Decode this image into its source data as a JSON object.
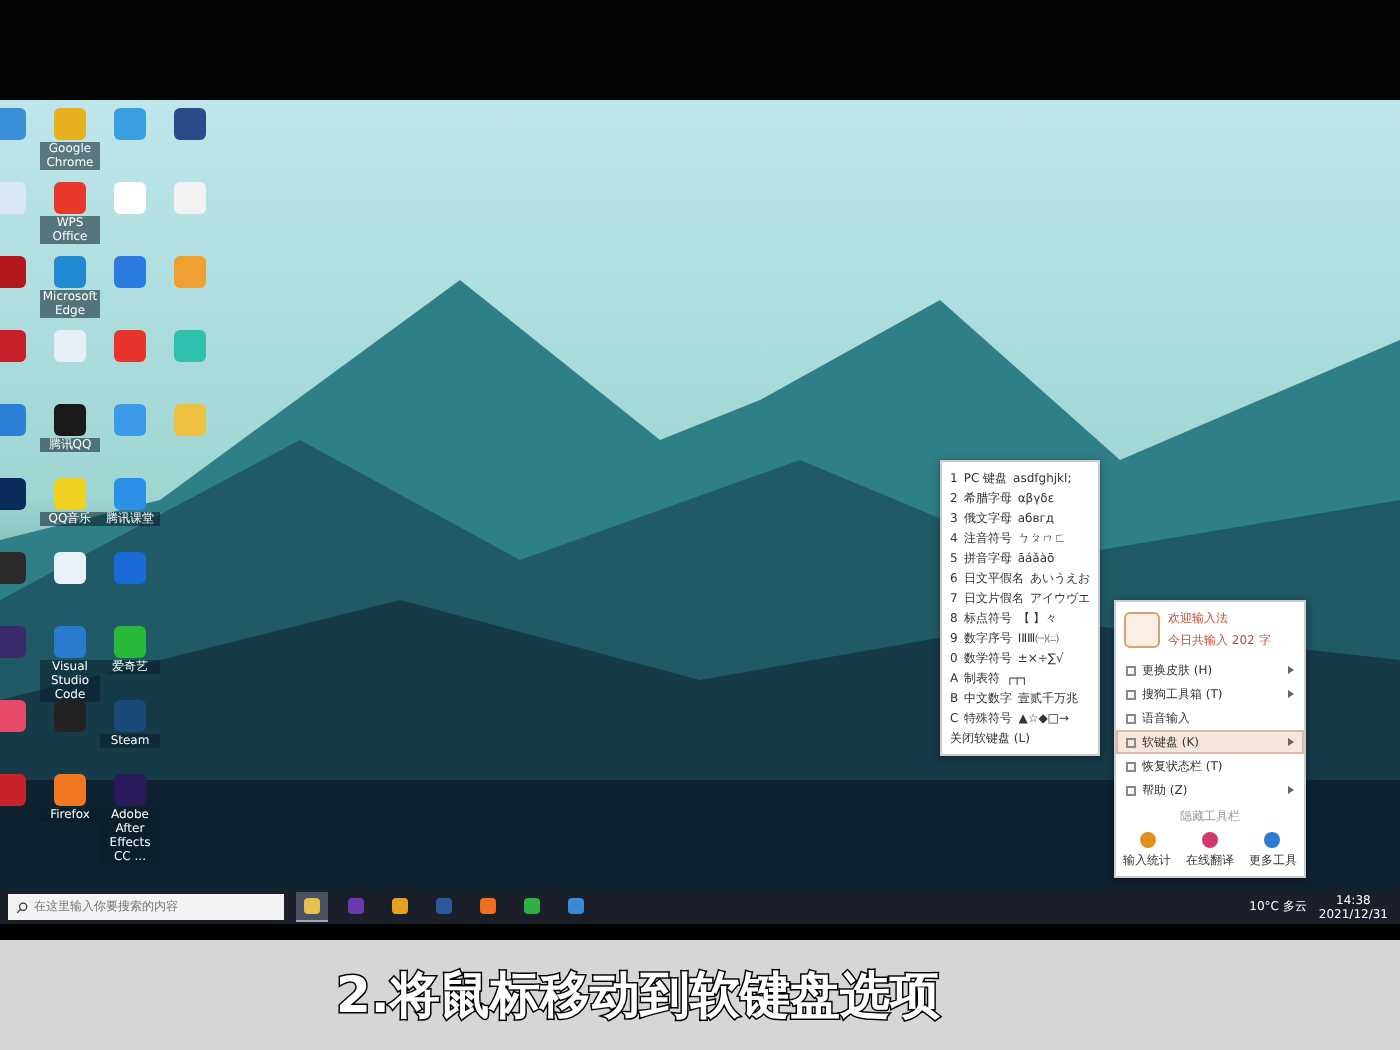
{
  "desktop_icons": [
    {
      "color": "#3a8fd8"
    },
    {
      "color": "#d9e8f5"
    },
    {
      "color": "#b0181c"
    },
    {
      "color": "#c61f2a"
    },
    {
      "color": "#2b7fd6"
    },
    {
      "color": "#0a2a5a"
    },
    {
      "color": "#2a2a2a"
    },
    {
      "color": "#3a2a6a"
    },
    {
      "color": "#e84a6a"
    },
    {
      "color": "#c8222a"
    },
    {
      "label": "Google Chrome",
      "color": "#e8b020"
    },
    {
      "label": "WPS Office",
      "color": "#e8382a"
    },
    {
      "label": "Microsoft Edge",
      "color": "#1f8ad2"
    },
    {
      "color": "#e8eef5"
    },
    {
      "label": "腾讯QQ",
      "color": "#1a1a1a"
    },
    {
      "label": "QQ音乐",
      "color": "#f0d020"
    },
    {
      "color": "#e8f0f8"
    },
    {
      "label": "Visual Studio Code",
      "color": "#2a7ad0"
    },
    {
      "color": "#222222"
    },
    {
      "label": "Firefox",
      "color": "#f07820"
    },
    {
      "color": "#3aa0e0"
    },
    {
      "color": "#ffffff"
    },
    {
      "color": "#2a7ae0"
    },
    {
      "color": "#e8342a"
    },
    {
      "color": "#3a9ae8"
    },
    {
      "label": "腾讯课堂",
      "color": "#2a90e8"
    },
    {
      "color": "#1a6ad8"
    },
    {
      "label": "爱奇艺",
      "color": "#2ab83a"
    },
    {
      "label": "Steam",
      "color": "#1a4a7a"
    },
    {
      "label": "Adobe After Effects CC ...",
      "color": "#2a1a5a"
    },
    {
      "color": "#2a4a8a"
    },
    {
      "color": "#f2f2f2"
    },
    {
      "color": "#f0a030"
    },
    {
      "color": "#30c0b0"
    },
    {
      "color": "#f0c040"
    }
  ],
  "soft_keyboard_menu": [
    {
      "key": "1",
      "name": "PC 键盘",
      "sample": "asdfghjkl;"
    },
    {
      "key": "2",
      "name": "希腊字母",
      "sample": "αβγδε"
    },
    {
      "key": "3",
      "name": "俄文字母",
      "sample": "абвгд"
    },
    {
      "key": "4",
      "name": "注音符号",
      "sample": "ㄅㄆㄇㄈ"
    },
    {
      "key": "5",
      "name": "拼音字母",
      "sample": "āáǎàō"
    },
    {
      "key": "6",
      "name": "日文平假名",
      "sample": "あいうえお"
    },
    {
      "key": "7",
      "name": "日文片假名",
      "sample": "アイウヴエ"
    },
    {
      "key": "8",
      "name": "标点符号",
      "sample": "【 】々"
    },
    {
      "key": "9",
      "name": "数字序号",
      "sample": "ⅠⅡⅢ㈠㈡"
    },
    {
      "key": "0",
      "name": "数学符号",
      "sample": "±×÷∑√"
    },
    {
      "key": "A",
      "name": "制表符",
      "sample": "┌┬┐"
    },
    {
      "key": "B",
      "name": "中文数字",
      "sample": "壹贰千万兆"
    },
    {
      "key": "C",
      "name": "特殊符号",
      "sample": "▲☆◆□→"
    }
  ],
  "soft_keyboard_close": "关闭软键盘 (L)",
  "ime_menu": {
    "greeting": "欢迎输入法",
    "count": "今日共输入 202 字",
    "items": [
      {
        "label": "更换皮肤 (H)",
        "submenu": true,
        "selected": false
      },
      {
        "label": "搜狗工具箱 (T)",
        "submenu": true,
        "selected": false
      },
      {
        "label": "语音输入",
        "submenu": false,
        "selected": false
      },
      {
        "label": "软键盘 (K)",
        "submenu": true,
        "selected": true
      },
      {
        "label": "恢复状态栏 (T)",
        "submenu": false,
        "selected": false
      },
      {
        "label": "帮助 (Z)",
        "submenu": true,
        "selected": false
      }
    ],
    "hide_toolbar": "隐藏工具栏",
    "tools": [
      {
        "label": "输入统计",
        "color": "#e09020"
      },
      {
        "label": "在线翻译",
        "color": "#d03a6a"
      },
      {
        "label": "更多工具",
        "color": "#2a7ad0"
      }
    ]
  },
  "taskbar": {
    "search_placeholder": "在这里输入你要搜索的内容",
    "apps": [
      {
        "color": "#e8c050",
        "selected": true
      },
      {
        "color": "#6a3ab0",
        "selected": false
      },
      {
        "color": "#e8a020",
        "selected": false
      },
      {
        "color": "#2a5a9a",
        "selected": false
      },
      {
        "color": "#f07020",
        "selected": false
      },
      {
        "color": "#30b040",
        "selected": false
      },
      {
        "color": "#3a8ad8",
        "selected": false
      }
    ],
    "weather": "10°C 多云",
    "time": "14:38",
    "date": "2021/12/31"
  },
  "caption": "2.将鼠标移动到软键盘选项"
}
